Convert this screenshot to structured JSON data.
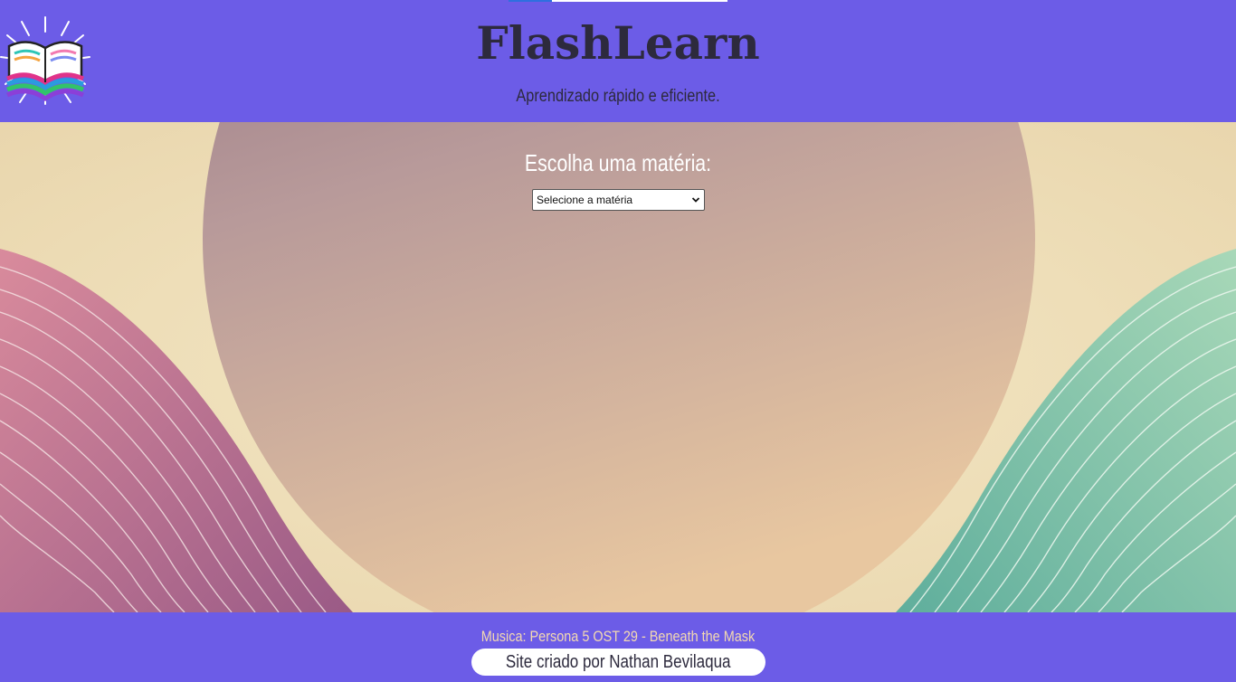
{
  "header": {
    "title": "FlashLearn",
    "subtitle": "Aprendizado rápido e eficiente.",
    "logo_icon": "open-book-icon"
  },
  "audio": {
    "progress": 0.2
  },
  "main": {
    "subject_label": "Escolha uma matéria:",
    "subject_select": {
      "selected": "Selecione a matéria"
    }
  },
  "footer": {
    "music_credit": "Musica: Persona 5 OST 29 - Beneath the Mask",
    "author_credit": "Site criado por Nathan Bevilaqua"
  },
  "colors": {
    "brand": "#6c5ce7",
    "title_text": "#2d2a3d",
    "music_text": "#f3d9b1",
    "background_cream": "#efe0b8"
  }
}
